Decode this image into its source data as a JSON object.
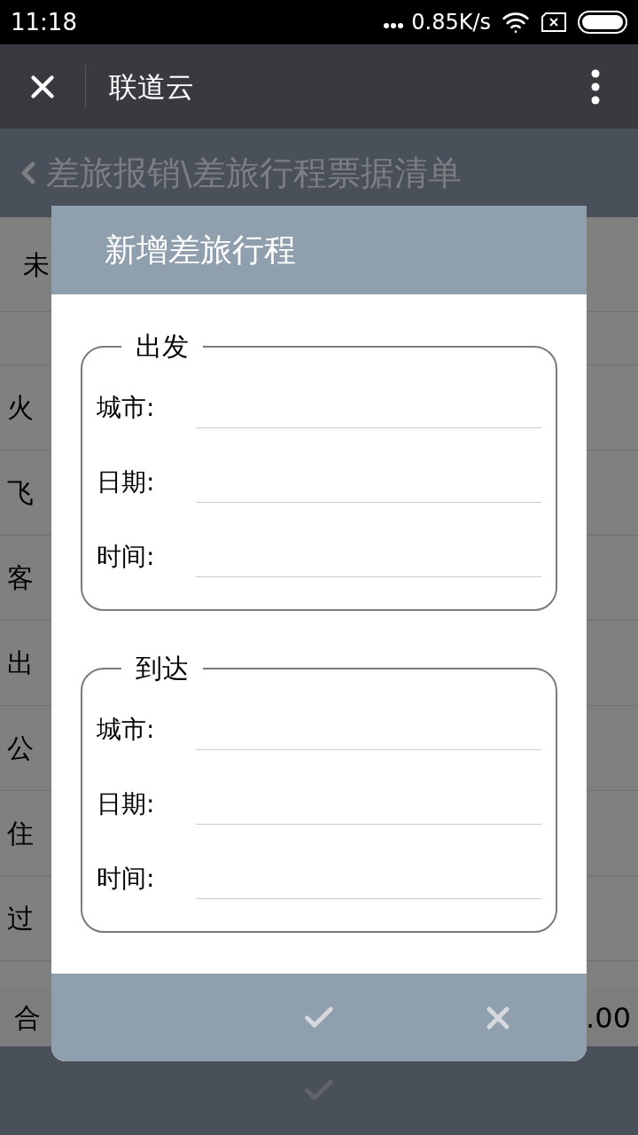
{
  "status_bar": {
    "time": "11:18",
    "network_speed": "0.85K/s"
  },
  "nav": {
    "title": "联道云"
  },
  "breadcrumb": "差旅报销\\差旅行程票据清单",
  "background": {
    "top_label": "未",
    "rows": [
      "火",
      "飞",
      "客",
      "出",
      "公",
      "住",
      "过"
    ],
    "total": {
      "label": "合",
      "value": ".00"
    }
  },
  "dialog": {
    "title": "新增差旅行程",
    "sections": [
      {
        "legend": "出发",
        "fields": [
          {
            "label": "城市:"
          },
          {
            "label": "日期:"
          },
          {
            "label": "时间:"
          }
        ]
      },
      {
        "legend": "到达",
        "fields": [
          {
            "label": "城市:"
          },
          {
            "label": "日期:"
          },
          {
            "label": "时间:"
          }
        ]
      }
    ]
  }
}
